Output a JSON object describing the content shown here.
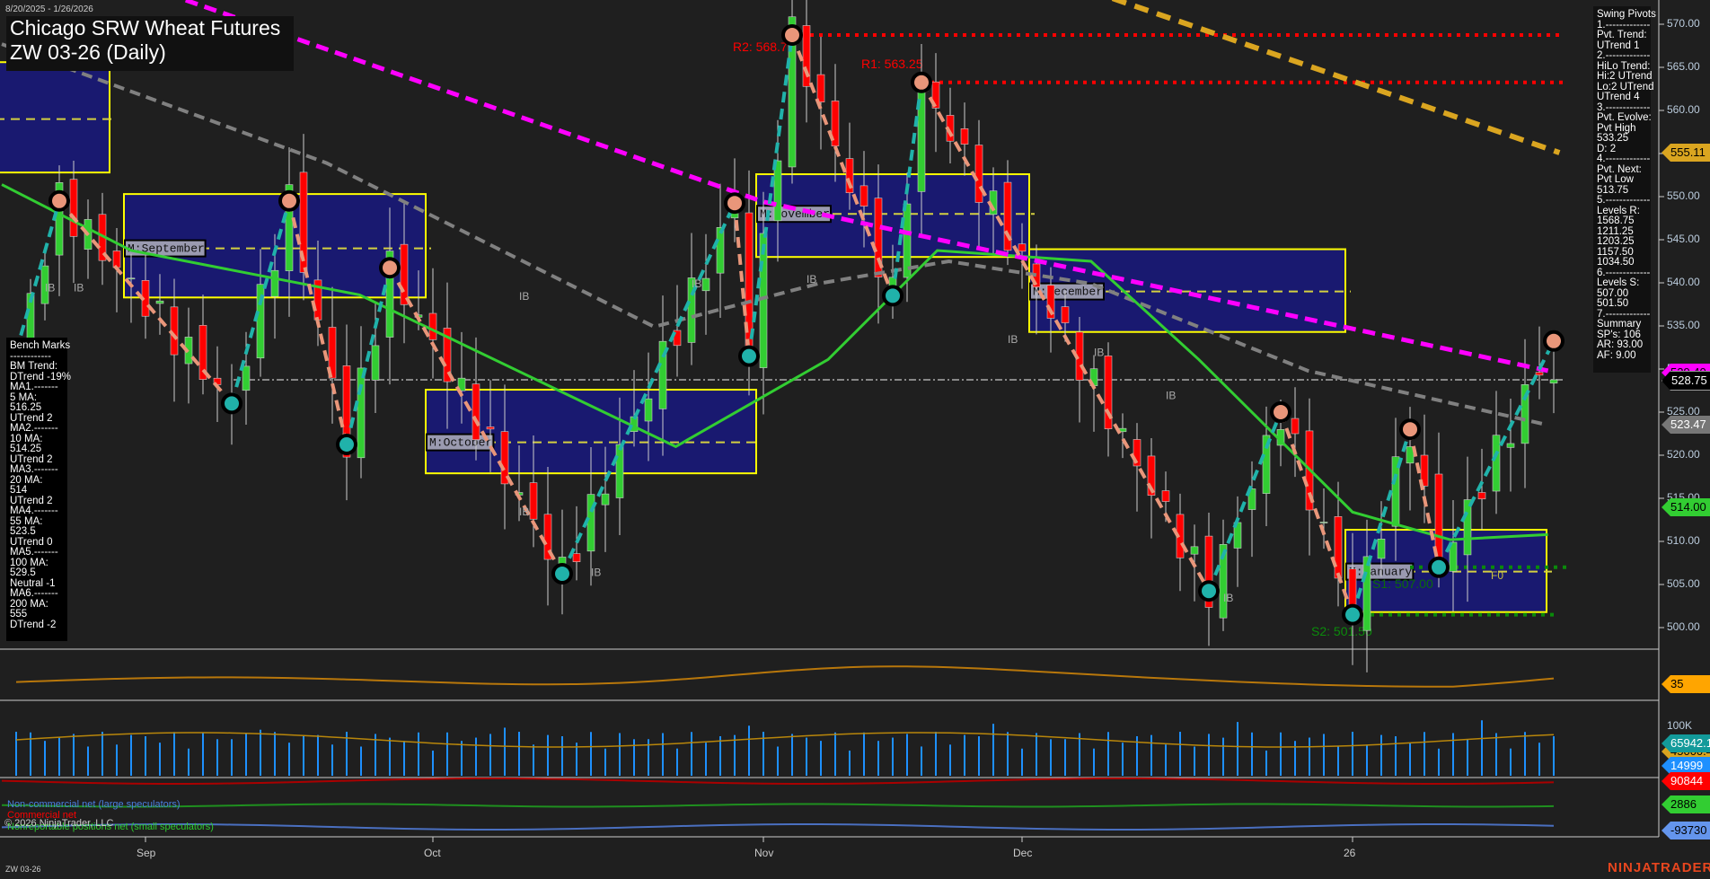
{
  "header": {
    "date_range": "8/20/2025 - 1/26/2026",
    "title": "Chicago SRW Wheat Futures",
    "subtitle": "ZW 03-26 (Daily)",
    "symbol": "ZW 03-26"
  },
  "swing_pivots_panel": [
    "Swing Pivots",
    "1.-------------",
    "Pvt. Trend:",
    "UTrend 1",
    "2.-------------",
    "HiLo Trend:",
    "Hi:2 UTrend",
    "Lo:2 UTrend",
    "UTrend 4",
    "3.-------------",
    "Pvt. Evolve:",
    "Pvt High",
    "533.25",
    "D: 2",
    "4.-------------",
    "Pvt. Next:",
    "Pvt Low",
    "513.75",
    "5.-------------",
    "Levels R:",
    "1568.75",
    "1211.25",
    "1203.25",
    "1157.50",
    "1034.50",
    "6.-------------",
    "Levels S:",
    "507.00",
    "501.50",
    "7.-------------",
    "Summary",
    "SP's: 106",
    "AR: 93.00",
    "AF: 9.00"
  ],
  "bench_marks_panel": [
    "Bench Marks",
    "------------",
    "BM Trend:",
    "DTrend -19%",
    "MA1.-------",
    "5 MA:",
    "516.25",
    "UTrend 2",
    "MA2.-------",
    "10 MA:",
    "514.25",
    "UTrend 2",
    "MA3.-------",
    "20 MA:",
    "514",
    "UTrend 2",
    "MA4.-------",
    "55 MA:",
    "523.5",
    "UTrend 0",
    "MA5.-------",
    "100 MA:",
    "529.5",
    "Neutral -1",
    "MA6.-------",
    "200 MA:",
    "555",
    "DTrend -2"
  ],
  "levels": {
    "r2": "R2: 568.75",
    "r1": "R1: 563.25",
    "s1": "S1: 507.00",
    "s2": "S2: 501.50",
    "r2_value": 568.75,
    "r1_value": 563.25,
    "s1_value": 507.0,
    "s2_value": 501.5,
    "f0": "F0"
  },
  "month_boxes": [
    {
      "label": "",
      "high": 565.6,
      "low": 552.8,
      "mid": 559,
      "from": -2,
      "to": 6
    },
    {
      "label": "M:September",
      "high": 550.3,
      "low": 538.3,
      "mid": 544,
      "from": 8,
      "to": 28
    },
    {
      "label": "M:October",
      "high": 527.6,
      "low": 517.9,
      "mid": 521.5,
      "from": 29,
      "to": 51
    },
    {
      "label": "M:November",
      "high": 552.6,
      "low": 543,
      "mid": 548,
      "from": 52,
      "to": 70
    },
    {
      "label": "M:December",
      "high": 543.9,
      "low": 534.3,
      "mid": 539,
      "from": 71,
      "to": 92
    },
    {
      "label": "M:January",
      "high": 511.35,
      "low": 501.8,
      "mid": 506.5,
      "from": 93,
      "to": 106
    }
  ],
  "ib_labels": [
    {
      "text": "IB",
      "bar": 2,
      "price": 539
    },
    {
      "text": "IB",
      "bar": 4,
      "price": 539
    },
    {
      "text": "IB",
      "bar": 40,
      "price": 506
    },
    {
      "text": "IB",
      "bar": 35,
      "price": 538
    },
    {
      "text": "IB",
      "bar": 35,
      "price": 513
    },
    {
      "text": "IB",
      "bar": 47,
      "price": 539.5
    },
    {
      "text": "IB",
      "bar": 55,
      "price": 540
    },
    {
      "text": "IB",
      "bar": 69,
      "price": 533
    },
    {
      "text": "IB",
      "bar": 75,
      "price": 531.5
    },
    {
      "text": "IB",
      "bar": 80,
      "price": 526.5
    },
    {
      "text": "IB",
      "bar": 84,
      "price": 503
    }
  ],
  "price_axis": {
    "ticks": [
      "570.00",
      "565.00",
      "560.00",
      "555.00",
      "550.00",
      "545.00",
      "540.00",
      "535.00",
      "530.00",
      "525.00",
      "520.00",
      "515.00",
      "510.00",
      "505.00",
      "500.00"
    ],
    "min": 500,
    "max": 570
  },
  "x_axis": [
    {
      "label": "Sep",
      "bar": 9
    },
    {
      "label": "Oct",
      "bar": 29
    },
    {
      "label": "Nov",
      "bar": 52
    },
    {
      "label": "Dec",
      "bar": 70
    },
    {
      "label": "26",
      "bar": 93
    }
  ],
  "tags": {
    "ma200": "555.11",
    "ma100": "529.40",
    "last": "528.75",
    "ma55": "523.47",
    "ma20": "514.00",
    "osc": "35",
    "vol_avg": "65942.11",
    "vol_ma": "45000.46",
    "volume": "14999",
    "cot_commercial": "90844",
    "cot_small": "2886",
    "cot_large": "-93730"
  },
  "sub_axes": {
    "osc_tick": "40",
    "vol_tick": "100K"
  },
  "cot_legend": {
    "large": "Non-commercial net (large speculators)",
    "commercial": "Commercial net",
    "small": "Nonreportable positions net (small speculators)"
  },
  "copyright": "© 2026 NinjaTrader, LLC",
  "brand": "NINJATRADER",
  "colors": {
    "up": "#32cd32",
    "down": "#ff0000",
    "ma100": "#ff00ff",
    "ma200": "#daa520",
    "ma55": "#808080",
    "ma20": "#32cd32",
    "box": "#191970",
    "box_border": "#ffff00",
    "swing_up": "#20b2aa",
    "swing_down": "#e9967a"
  },
  "chart_data": {
    "type": "candlestick",
    "title": "Chicago SRW Wheat Futures ZW 03-26 (Daily)",
    "ylim": [
      498,
      572
    ],
    "swing_pivots": [
      [
        0,
        532
      ],
      [
        3,
        549.5
      ],
      [
        15,
        526
      ],
      [
        19,
        549.5
      ],
      [
        23,
        521.25
      ],
      [
        26,
        541.75
      ],
      [
        38,
        506.25
      ],
      [
        50,
        549.25
      ],
      [
        51,
        531.5
      ],
      [
        54,
        568.75
      ],
      [
        61,
        538.5
      ],
      [
        63,
        563.25
      ],
      [
        83,
        504.25
      ],
      [
        88,
        525
      ],
      [
        93,
        501.5
      ],
      [
        97,
        523
      ],
      [
        99,
        507
      ],
      [
        107,
        533.25
      ]
    ],
    "last_close": 528.75,
    "ma100": [
      [
        11.8,
        572.8
      ],
      [
        52,
        549.4
      ],
      [
        74.8,
        541.2
      ],
      [
        106.6,
        529.8
      ]
    ],
    "ma200": [
      [
        76.3,
        573
      ],
      [
        93.7,
        563
      ],
      [
        107.4,
        555.1
      ]
    ],
    "ma55": [
      [
        -1,
        567.7
      ],
      [
        21.6,
        553.9
      ],
      [
        44.4,
        534.9
      ],
      [
        55.8,
        539.9
      ],
      [
        64.9,
        542.5
      ],
      [
        74.8,
        539.9
      ],
      [
        89.9,
        529.8
      ],
      [
        106.6,
        523.5
      ]
    ],
    "ma20": [
      [
        -1,
        551.4
      ],
      [
        8,
        543.75
      ],
      [
        23.9,
        538.6
      ],
      [
        45.9,
        521
      ],
      [
        56.5,
        531.1
      ],
      [
        64.1,
        543.75
      ],
      [
        74.8,
        542.5
      ],
      [
        82.3,
        531.1
      ],
      [
        93,
        513.4
      ],
      [
        99.8,
        510.2
      ],
      [
        106.6,
        510.8
      ]
    ],
    "oscillator": {
      "current": 35,
      "range": [
        30,
        48
      ]
    },
    "volume": {
      "last": 14999,
      "avg": 65942.11
    },
    "cot": {
      "commercial": 90844,
      "small": 2886,
      "large": -93730
    }
  }
}
